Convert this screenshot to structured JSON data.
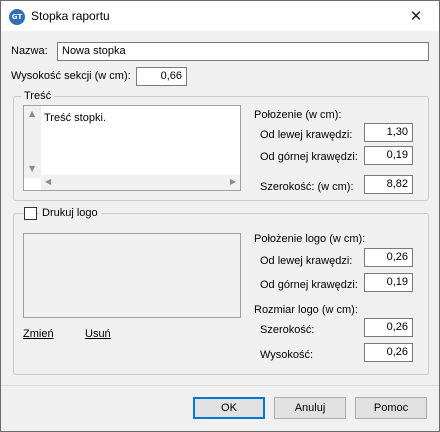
{
  "window": {
    "title": "Stopka raportu",
    "app_icon_text": "GT",
    "close_glyph": "✕"
  },
  "name_field": {
    "label": "Nazwa:",
    "value": "Nowa stopka"
  },
  "section_height": {
    "label": "Wysokość sekcji (w cm):",
    "value": "0,66"
  },
  "content_group": {
    "legend": "Treść",
    "text": "Treść stopki.",
    "position_title": "Położenie (w cm):",
    "left_label": "Od lewej krawędzi:",
    "left_value": "1,30",
    "top_label": "Od górnej krawędzi:",
    "top_value": "0,19",
    "width_label": "Szerokość: (w cm):",
    "width_value": "8,82"
  },
  "logo_group": {
    "checkbox_label": "Drukuj logo",
    "change_link": "Zmień",
    "remove_link": "Usuń",
    "position_title": "Położenie logo (w cm):",
    "left_label": "Od lewej krawędzi:",
    "left_value": "0,26",
    "top_label": "Od górnej krawędzi:",
    "top_value": "0,19",
    "size_title": "Rozmiar logo (w cm):",
    "width_label": "Szerokość:",
    "width_value": "0,26",
    "height_label": "Wysokość:",
    "height_value": "0,26"
  },
  "buttons": {
    "ok": "OK",
    "cancel": "Anuluj",
    "help": "Pomoc"
  },
  "icons": {
    "scroll_up": "▲",
    "scroll_down": "▼",
    "scroll_left": "◀",
    "scroll_right": "▶"
  }
}
